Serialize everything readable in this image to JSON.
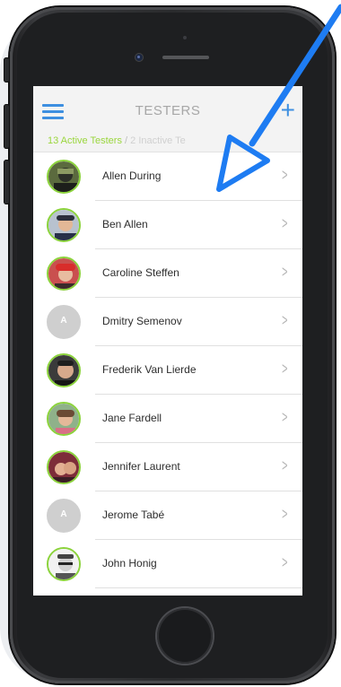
{
  "header": {
    "title": "TESTERS",
    "menu_icon": "hamburger-icon",
    "add_icon": "plus-icon"
  },
  "filter": {
    "active_label": "13 Active Testers",
    "separator": "/",
    "inactive_label": "2 Inactive Te"
  },
  "testers": [
    {
      "name": "Allen During",
      "avatar": "photo",
      "initial": ""
    },
    {
      "name": "Ben Allen",
      "avatar": "photo",
      "initial": ""
    },
    {
      "name": "Caroline Steffen",
      "avatar": "photo",
      "initial": ""
    },
    {
      "name": "Dmitry Semenov",
      "avatar": "initial",
      "initial": "A"
    },
    {
      "name": "Frederik Van Lierde",
      "avatar": "photo",
      "initial": ""
    },
    {
      "name": "Jane Fardell",
      "avatar": "photo",
      "initial": ""
    },
    {
      "name": "Jennifer Laurent",
      "avatar": "photo",
      "initial": ""
    },
    {
      "name": "Jerome Tabé",
      "avatar": "initial",
      "initial": "A"
    },
    {
      "name": "John Honig",
      "avatar": "photo",
      "initial": ""
    }
  ],
  "chevron_glyph": ">",
  "colors": {
    "accent_blue": "#3d8fe0",
    "active_green": "#9ad63c",
    "pointer_blue": "#1e7cf2"
  }
}
